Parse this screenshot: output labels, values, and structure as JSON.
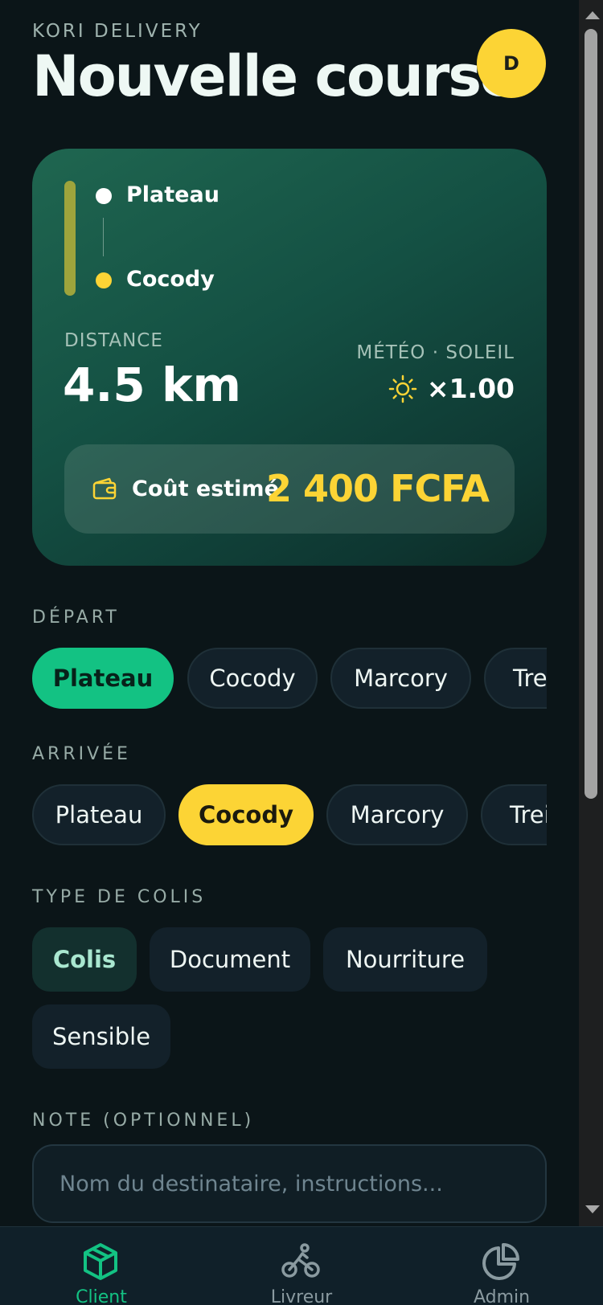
{
  "header": {
    "brand": "KORI DELIVERY",
    "title": "Nouvelle course",
    "avatar_initial": "D"
  },
  "route": {
    "from": "Plateau",
    "to": "Cocody",
    "distance_label": "DISTANCE",
    "distance_value": "4.5 km",
    "meteo_label": "MÉTÉO · SOLEIL",
    "meteo_icon": "sun-icon",
    "multiplier": "×1.00",
    "cost_label": "Coût estimé",
    "cost_value": "2 400 FCFA"
  },
  "depart": {
    "label": "DÉPART",
    "options": [
      "Plateau",
      "Cocody",
      "Marcory",
      "Tre"
    ],
    "selected": "Plateau"
  },
  "arrivee": {
    "label": "ARRIVÉE",
    "options": [
      "Plateau",
      "Cocody",
      "Marcory",
      "Trei"
    ],
    "selected": "Cocody"
  },
  "colis": {
    "label": "TYPE DE COLIS",
    "options": [
      "Colis",
      "Document",
      "Nourriture",
      "Sensible"
    ],
    "selected": "Colis"
  },
  "note": {
    "label": "NOTE (OPTIONNEL)",
    "placeholder": "Nom du destinataire, instructions..."
  },
  "nav": [
    {
      "label": "Client",
      "icon": "package-icon",
      "active": true
    },
    {
      "label": "Livreur",
      "icon": "bike-icon",
      "active": false
    },
    {
      "label": "Admin",
      "icon": "pie-chart-icon",
      "active": false
    }
  ],
  "colors": {
    "accent_green": "#13c283",
    "accent_yellow": "#fcd435",
    "background": "#0b1518"
  }
}
